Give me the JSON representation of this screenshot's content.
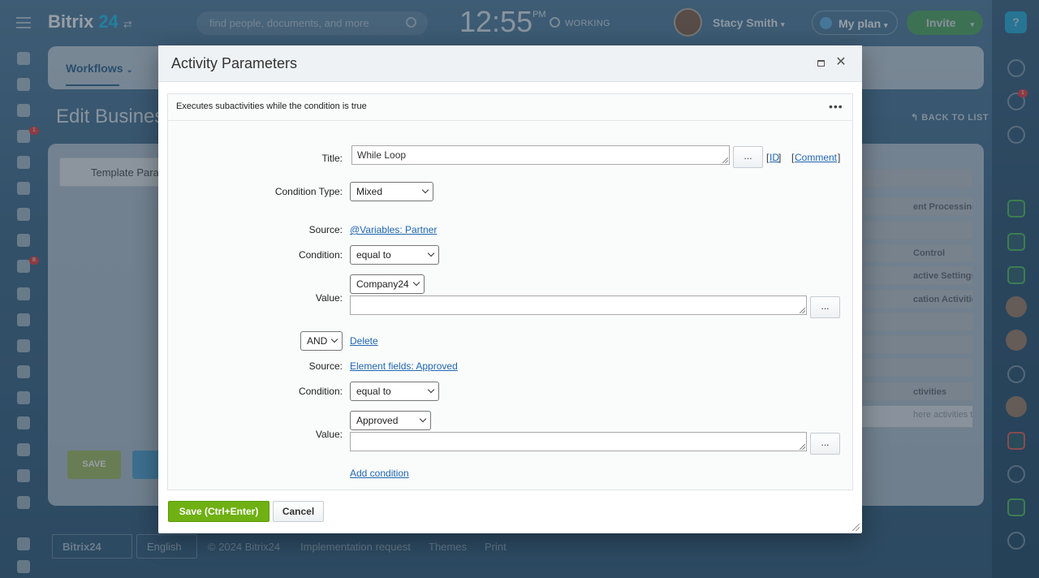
{
  "header": {
    "logo_text": "Bitrix",
    "logo_number": "24",
    "search_placeholder": "find people, documents, and more",
    "clock_time": "12:55",
    "clock_ampm": "PM",
    "status": "WORKING",
    "user_name": "Stacy Smith",
    "plan_label": "My plan",
    "invite_label": "Invite",
    "help_label": "?"
  },
  "left_rail": {
    "badges": [
      "1",
      "8"
    ]
  },
  "right_rail": {
    "notification_badge": "1"
  },
  "background": {
    "tab_workflows": "Workflows",
    "page_title": "Edit Business",
    "back_to_list": "BACK TO LIST",
    "template_params": "Template Para",
    "right_buttons": [
      "",
      "ent Processing",
      "",
      "Control",
      "active Settings",
      "cation Activities",
      "",
      "",
      "",
      "ctivities"
    ],
    "right_hint": "here activities to save",
    "save": "SAVE",
    "footer": {
      "bitrix_badge": "Bitrix24",
      "language": "English",
      "copyright": "© 2024 Bitrix24",
      "links": [
        "Implementation request",
        "Themes",
        "Print"
      ]
    }
  },
  "dialog": {
    "title": "Activity Parameters",
    "description": "Executes subactivities while the condition is true",
    "labels": {
      "title": "Title:",
      "condition_type": "Condition Type:",
      "source": "Source:",
      "condition": "Condition:",
      "value": "Value:"
    },
    "title_value": "While Loop",
    "dots": "...",
    "id_link": "ID",
    "comment_link": "Comment",
    "condition_type_value": "Mixed",
    "conditions": [
      {
        "source": "@Variables: Partner",
        "operator": "equal to",
        "value_select": "Company24",
        "value_text": ""
      },
      {
        "join": "AND",
        "delete_label": "Delete",
        "source": "Element fields: Approved",
        "operator": "equal to",
        "value_select": "Approved",
        "value_text": ""
      }
    ],
    "add_condition": "Add condition",
    "save_button": "Save (Ctrl+Enter)",
    "cancel_button": "Cancel"
  },
  "colors": {
    "accent_green": "#6fb012",
    "link_blue": "#2067b0",
    "brand_blue": "#2fc6f6"
  }
}
